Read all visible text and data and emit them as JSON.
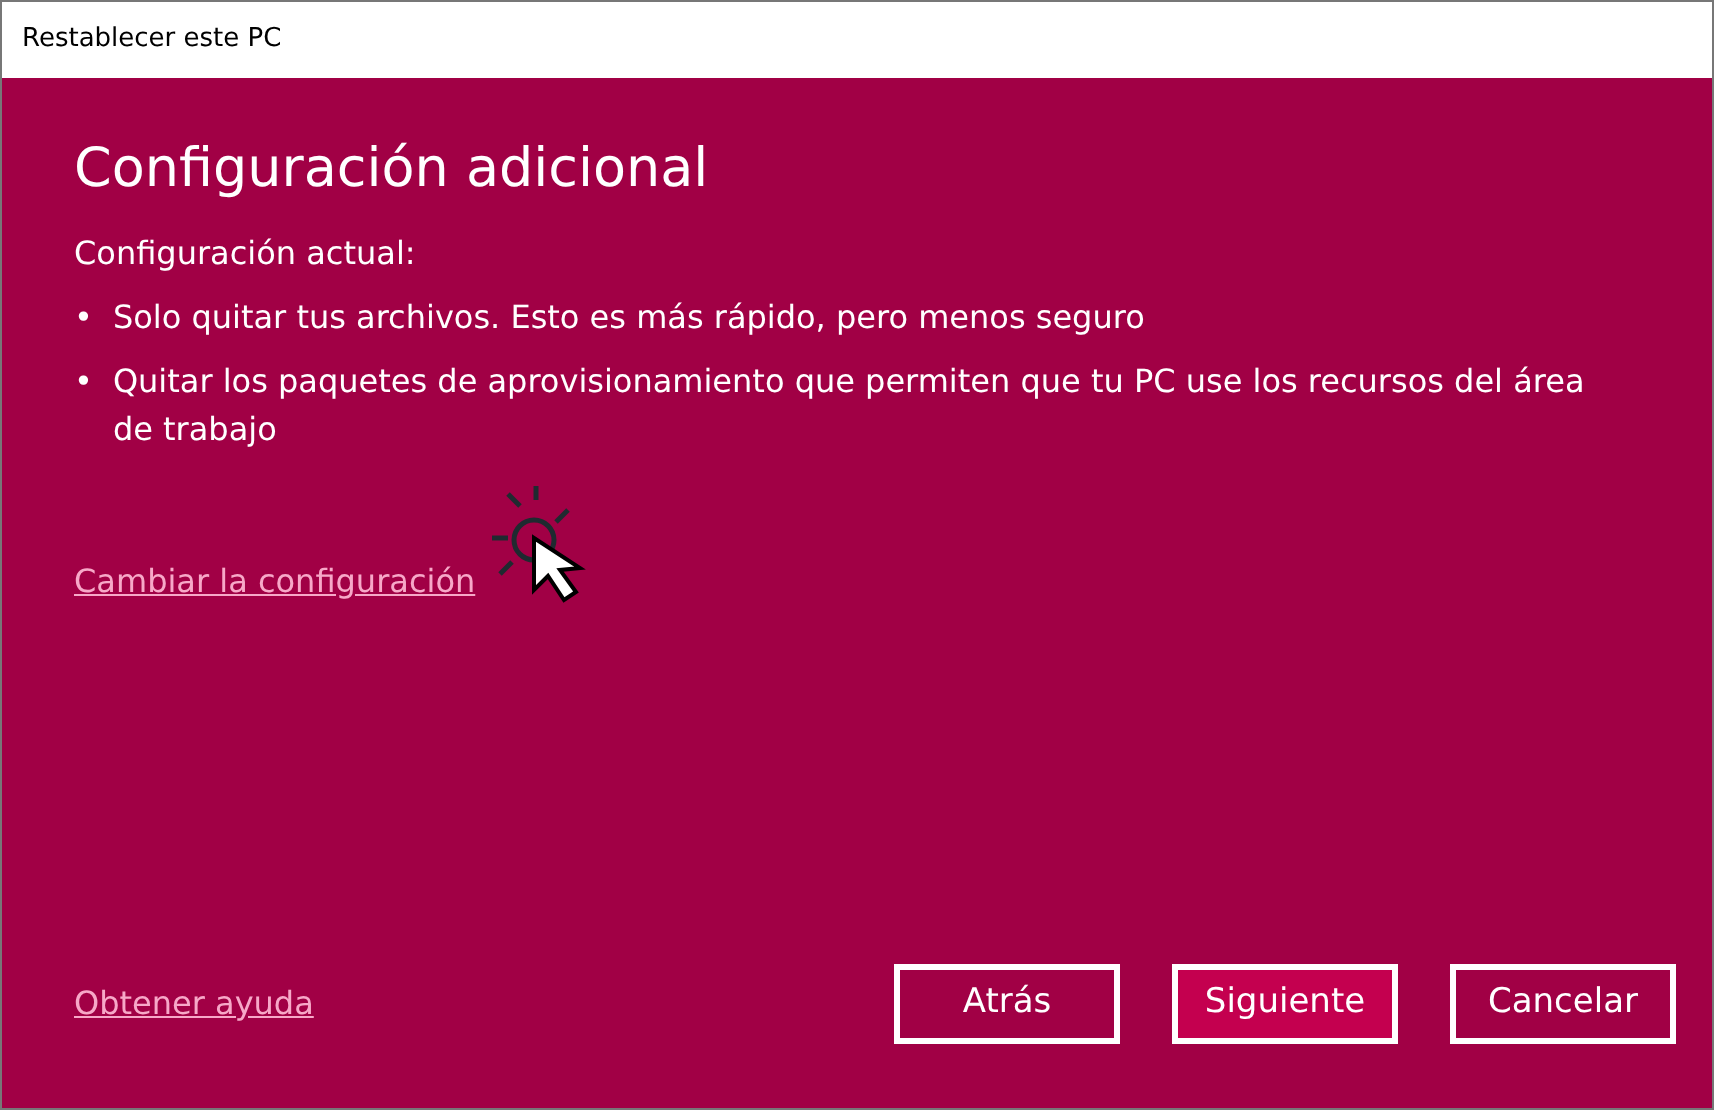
{
  "window": {
    "title": "Restablecer este PC"
  },
  "heading": "Configuración adicional",
  "settings_label": "Configuración actual:",
  "bullets": [
    {
      "marker": "•",
      "text": "Solo quitar tus archivos. Esto es más rápido, pero menos seguro"
    },
    {
      "marker": "•",
      "text": "Quitar los paquetes de aprovisionamiento que permiten que tu PC use los recursos del área de trabajo"
    }
  ],
  "change_link": "Cambiar la configuración",
  "help_link": "Obtener ayuda",
  "buttons": [
    {
      "label": "Atrás",
      "selected": false
    },
    {
      "label": "Siguiente",
      "selected": true
    },
    {
      "label": "Cancelar",
      "selected": false
    }
  ]
}
